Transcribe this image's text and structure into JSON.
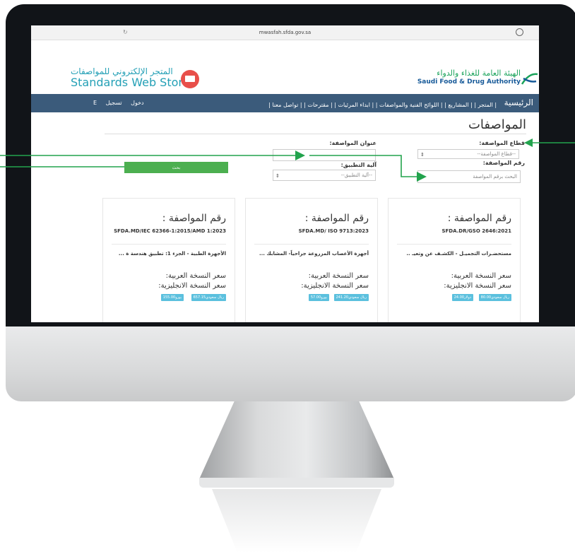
{
  "colors": {
    "nav": "#3b5b7b",
    "accent": "#4caf50",
    "badge": "#5bc0de",
    "arrow": "#22a34d"
  },
  "browser": {
    "url": "mwasfah.sfda.gov.sa"
  },
  "store": {
    "name_ar": "المتجر الإلكتروني للمواصفات",
    "name_en": "Standards Web Store"
  },
  "sfda": {
    "name_ar": "الهيئة العامة للغذاء والدواء",
    "name_en": "Saudi Food & Drug Authority"
  },
  "nav": {
    "home": "الرئيسية",
    "items": [
      "| المتجر |",
      "| المشاريع |",
      "| اللوائح الفنية والمواصفات |",
      "| ابداء المرئيات |",
      "| مقترحات |",
      "| تواصل معنا |"
    ],
    "register": "تسجيل",
    "login": "دخول",
    "lang": "E"
  },
  "page": {
    "title": "المواصفات"
  },
  "form": {
    "sector_label": "قطاع المواصفة:",
    "sector_value": "--قطاع المواصفة--",
    "number_label": "رقم المواصفة:",
    "number_placeholder": "البحث برقم المواصفة",
    "title_label": "عنوان المواصفة:",
    "mechanism_label": "آلية التطبيق:",
    "mechanism_value": "--آلية التطبيق--",
    "search_button": "بحث"
  },
  "cards": [
    {
      "number_label": "رقم المواصفة :",
      "code": "SFDA.DR/GSO 2646:2021",
      "name": "مستحضـرات التجميـل - الكشـف عن وتعيـ ..",
      "price_ar_label": "سعر النسخة العربية:",
      "price_en_label": "سعر النسخة الانجليزية:",
      "badge1": "80.00ريال سعودي",
      "badge2": "24.00دولار"
    },
    {
      "number_label": "رقم المواصفة :",
      "code": "SFDA.MD/ ISO 9713:2023",
      "name": "أجهزة الأعصاب المزروعة جراحياً- المشابك ...",
      "price_ar_label": "سعر النسخة العربية:",
      "price_en_label": "سعر النسخة الانجليزية:",
      "badge1": "241.20ريال سعودي",
      "badge2": "57.00يورو"
    },
    {
      "number_label": "رقم المواصفة :",
      "code": "SFDA.MD/IEC 62366-1:2015/AMD 1:2023",
      "name": "الأجهزة الطبية - الجزء 1: تطبيق هندسة ة ...",
      "price_ar_label": "سعر النسخة العربية:",
      "price_en_label": "سعر النسخة الانجليزية:",
      "badge1": "657.15ريال سعودي",
      "badge2": "155.00يورو"
    }
  ]
}
